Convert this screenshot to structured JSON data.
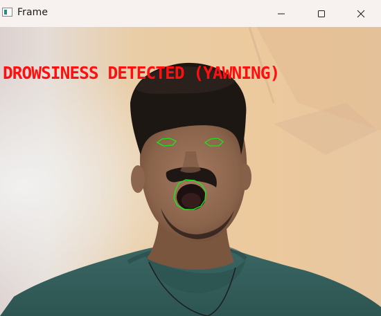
{
  "window": {
    "title": "Frame",
    "app_icon": "opencv-window-icon",
    "controls": {
      "minimize_icon": "minimize-icon",
      "maximize_icon": "maximize-icon",
      "close_icon": "close-icon"
    }
  },
  "camera": {
    "alert_text": "DROWSINESS DETECTED (YAWNING)",
    "alert_color": "#ff1010",
    "landmark_color": "#19e619",
    "landmarks": [
      "left-eye-contour",
      "right-eye-contour",
      "mouth-contour"
    ]
  }
}
